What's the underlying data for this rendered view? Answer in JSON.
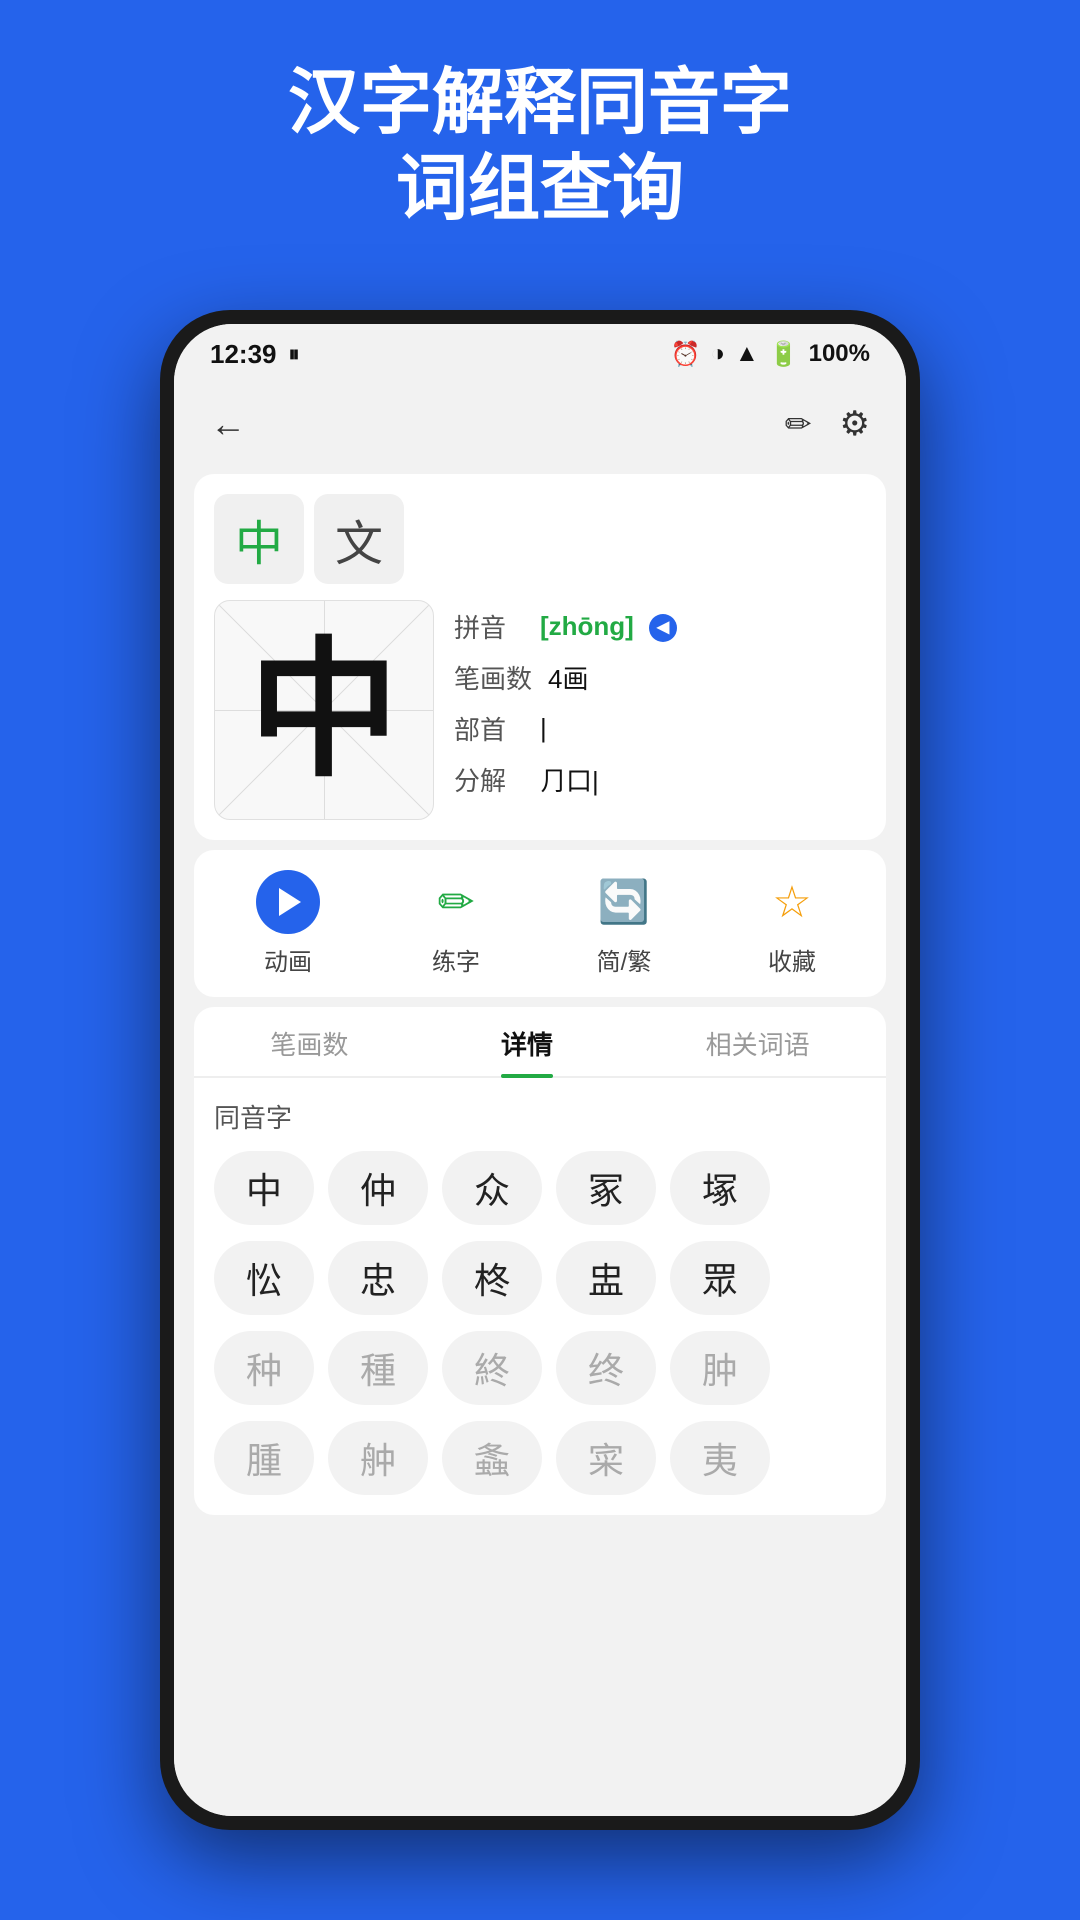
{
  "page": {
    "background_color": "#2563eb"
  },
  "top_title": {
    "line1": "汉字解释同音字",
    "line2": "词组查询"
  },
  "status_bar": {
    "time": "12:39",
    "battery": "100%",
    "icons": [
      "clock",
      "brightness",
      "wifi",
      "battery"
    ]
  },
  "top_bar": {
    "back_label": "←",
    "edit_icon": "✏",
    "settings_icon": "⚙"
  },
  "character_card": {
    "selected_chars": [
      {
        "char": "中",
        "active": true
      },
      {
        "char": "文",
        "active": false
      }
    ],
    "big_char": "中",
    "pinyin_label": "拼音",
    "pinyin_value": "[zhōng]",
    "stroke_label": "笔画数",
    "stroke_value": "4画",
    "radical_label": "部首",
    "radical_value": "|",
    "decompose_label": "分解",
    "decompose_value": "⺆口|"
  },
  "action_bar": {
    "items": [
      {
        "id": "animation",
        "label": "动画",
        "type": "play"
      },
      {
        "id": "practice",
        "label": "练字",
        "type": "pencil"
      },
      {
        "id": "simplified",
        "label": "简/繁",
        "type": "refresh"
      },
      {
        "id": "favorite",
        "label": "收藏",
        "type": "star"
      }
    ]
  },
  "tabs": {
    "items": [
      {
        "id": "strokes",
        "label": "笔画数",
        "active": false
      },
      {
        "id": "details",
        "label": "详情",
        "active": true
      },
      {
        "id": "related",
        "label": "相关词语",
        "active": false
      }
    ]
  },
  "homophones": {
    "section_title": "同音字",
    "rows": [
      [
        {
          "char": "中",
          "dim": false
        },
        {
          "char": "仲",
          "dim": false
        },
        {
          "char": "众",
          "dim": false
        },
        {
          "char": "冢",
          "dim": false
        },
        {
          "char": "塚",
          "dim": false
        }
      ],
      [
        {
          "char": "忪",
          "dim": false
        },
        {
          "char": "忠",
          "dim": false
        },
        {
          "char": "柊",
          "dim": false
        },
        {
          "char": "盅",
          "dim": false
        },
        {
          "char": "眾",
          "dim": false
        }
      ],
      [
        {
          "char": "种",
          "dim": true
        },
        {
          "char": "種",
          "dim": true
        },
        {
          "char": "終",
          "dim": true
        },
        {
          "char": "终",
          "dim": true
        },
        {
          "char": "肿",
          "dim": true
        }
      ],
      [
        {
          "char": "腫",
          "dim": true
        },
        {
          "char": "舯",
          "dim": true
        },
        {
          "char": "螽",
          "dim": true
        },
        {
          "char": "寀",
          "dim": true
        },
        {
          "char": "夷",
          "dim": true
        }
      ]
    ]
  }
}
